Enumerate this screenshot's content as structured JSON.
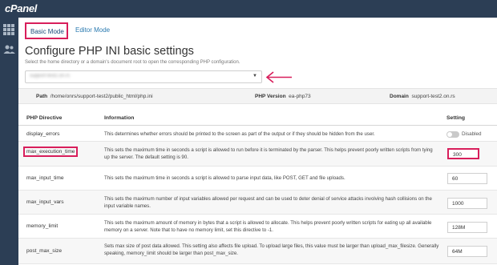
{
  "header": {
    "logo": "cPanel"
  },
  "sidebar": {
    "icons": [
      "grid-icon",
      "users-icon"
    ]
  },
  "tabs": [
    {
      "label": "Basic Mode",
      "active": true
    },
    {
      "label": "Editor Mode",
      "active": false
    }
  ],
  "page": {
    "title": "Configure PHP INI basic settings",
    "subtitle": "Select the home directory or a domain's document root to open the corresponding PHP configuration."
  },
  "location_select": {
    "value": "support-test2.on.rs"
  },
  "infobar": {
    "path_label": "Path",
    "path_value": "/home/onrs/support-test2/public_html/php.ini",
    "version_label": "PHP Version",
    "version_value": "ea-php73",
    "domain_label": "Domain",
    "domain_value": "support-test2.on.rs"
  },
  "table": {
    "headers": {
      "directive": "PHP Directive",
      "info": "Information",
      "setting": "Setting"
    },
    "rows": [
      {
        "directive": "display_errors",
        "info": "This determines whether errors should be printed to the screen as part of the output or if they should be hidden from the user.",
        "type": "toggle",
        "value": "Disabled"
      },
      {
        "directive": "max_execution_time",
        "info": "This sets the maximum time in seconds a script is allowed to run before it is terminated by the parser. This helps prevent poorly written scripts from tying up the server. The default setting is 90.",
        "type": "input",
        "value": "300"
      },
      {
        "directive": "max_input_time",
        "info": "This sets the maximum time in seconds a script is allowed to parse input data, like POST, GET and file uploads.",
        "type": "input",
        "value": "60"
      },
      {
        "directive": "max_input_vars",
        "info": "This sets the maximum number of input variables allowed per request and can be used to deter denial of service attacks involving hash collisions on the input variable names.",
        "type": "input",
        "value": "1000"
      },
      {
        "directive": "memory_limit",
        "info": "This sets the maximum amount of memory in bytes that a script is allowed to allocate. This helps prevent poorly written scripts for eating up all available memory on a server. Note that to have no memory limit, set this directive to -1.",
        "type": "input",
        "value": "128M"
      },
      {
        "directive": "post_max_size",
        "info": "Sets max size of post data allowed. This setting also affects file upload. To upload large files, this value must be larger than upload_max_filesize. Generally speaking, memory_limit should be larger than post_max_size.",
        "type": "input",
        "value": "64M"
      }
    ]
  },
  "colors": {
    "highlight": "#d81e5b",
    "nav": "#2c3e55",
    "link": "#2a7ab0"
  }
}
